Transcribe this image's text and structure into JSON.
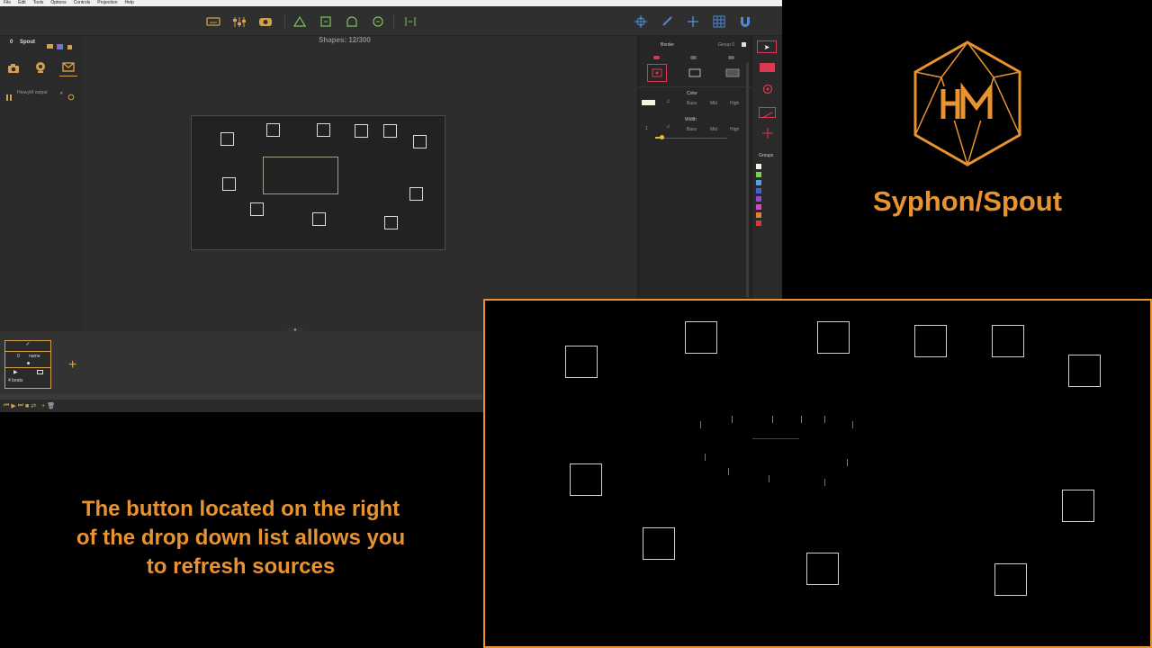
{
  "menubar": {
    "items": [
      "File",
      "Edit",
      "Tools",
      "Options",
      "Controls",
      "Projection",
      "Help"
    ]
  },
  "stage": {
    "shapes_label": "Shapes: 12/300"
  },
  "leftpanel": {
    "spout_num": "0",
    "spout_title": "Spout",
    "source_name": "HeavyM output"
  },
  "rightpanel": {
    "border_label": "Border",
    "group_label": "Group 0",
    "color_label": "Color",
    "width_label": "Width",
    "freq_low": "Bass",
    "freq_mid": "Mid",
    "freq_high": "High",
    "width_value": "1",
    "groups_label": "Groups",
    "group_colors": [
      "#f4f4e0",
      "#7ccf52",
      "#4aa6e8",
      "#4660d8",
      "#8f4ad8",
      "#d844c4",
      "#e8812f",
      "#d43a3a"
    ]
  },
  "timeline": {
    "cue_num": "0",
    "cue_name": "name",
    "cue_beats": "4 beats"
  },
  "brand": {
    "text": "Syphon/Spout",
    "accent": "#e8932f"
  },
  "caption": {
    "line1": "The button located on the right",
    "line2": "of the drop down list allows you",
    "line3": "to refresh sources"
  },
  "icons": {
    "toolbar_left": [
      "keyboard-icon",
      "mixer-icon",
      "media-icon"
    ],
    "toolbar_shapes": [
      "triangle-icon",
      "square-icon",
      "dome-icon",
      "circle-icon",
      "split-icon"
    ],
    "toolbar_right": [
      "move-icon",
      "brush-icon",
      "crosshair-icon",
      "grid-icon",
      "magnet-icon"
    ]
  }
}
